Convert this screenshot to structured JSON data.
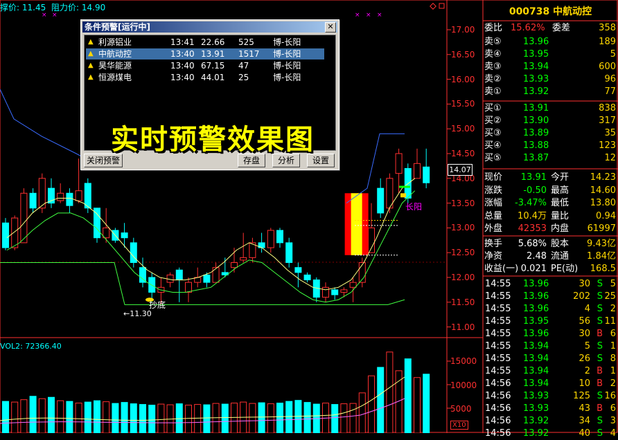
{
  "header": {
    "support_label": "撑价: 11.45",
    "resistance_label": "阻力价: 14.90"
  },
  "volume_header": "VOL2: 72366.40",
  "price_axis": [
    "17.00",
    "16.50",
    "16.00",
    "15.50",
    "15.00",
    "14.50",
    "14.00",
    "13.50",
    "13.00",
    "12.50",
    "12.00",
    "11.50",
    "11.00"
  ],
  "volume_axis": [
    "15000",
    "10000",
    "5000"
  ],
  "last_price_tag": "14.07",
  "x10_label": "X10",
  "annotations": {
    "chaodi": "抄底",
    "low": "←11.30",
    "changyang": "长阳"
  },
  "dialog": {
    "title": "条件预警[运行中]",
    "close": "✕",
    "rows": [
      {
        "name": "利源铝业",
        "time": "13:41",
        "price": "22.66",
        "volume": "525",
        "signal": "博-长阳",
        "selected": false
      },
      {
        "name": "中航动控",
        "time": "13:40",
        "price": "13.91",
        "volume": "1517",
        "signal": "博-长阳",
        "selected": true
      },
      {
        "name": "昊华能源",
        "time": "13:40",
        "price": "67.15",
        "volume": "47",
        "signal": "博-长阳",
        "selected": false
      },
      {
        "name": "恒源煤电",
        "time": "13:40",
        "price": "44.01",
        "volume": "25",
        "signal": "博-长阳",
        "selected": false
      }
    ],
    "caption": "实时预警效果图",
    "buttons": {
      "close_alert": "关闭预警",
      "save": "存盘",
      "analyze": "分析",
      "settings": "设置"
    }
  },
  "panel": {
    "title": "000738 中航动控",
    "webi": {
      "label": "委比",
      "value": "15.62%",
      "label2": "委差",
      "value2": "358"
    },
    "asks": [
      {
        "label": "卖⑤",
        "price": "13.96",
        "vol": "189"
      },
      {
        "label": "卖④",
        "price": "13.95",
        "vol": "5"
      },
      {
        "label": "卖③",
        "price": "13.94",
        "vol": "600"
      },
      {
        "label": "卖②",
        "price": "13.93",
        "vol": "96"
      },
      {
        "label": "卖①",
        "price": "13.92",
        "vol": "77"
      }
    ],
    "bids": [
      {
        "label": "买①",
        "price": "13.91",
        "vol": "838"
      },
      {
        "label": "买②",
        "price": "13.90",
        "vol": "317"
      },
      {
        "label": "买③",
        "price": "13.89",
        "vol": "35"
      },
      {
        "label": "买④",
        "price": "13.88",
        "vol": "123"
      },
      {
        "label": "买⑤",
        "price": "13.87",
        "vol": "12"
      }
    ],
    "stats": [
      {
        "l1": "现价",
        "v1": "13.91",
        "c1": "green",
        "l2": "今开",
        "v2": "14.23",
        "c2": "red"
      },
      {
        "l1": "涨跌",
        "v1": "-0.50",
        "c1": "green",
        "l2": "最高",
        "v2": "14.60",
        "c2": "red"
      },
      {
        "l1": "涨幅",
        "v1": "-3.47%",
        "c1": "green",
        "l2": "最低",
        "v2": "13.80",
        "c2": "green"
      },
      {
        "l1": "总量",
        "v1": "10.4万",
        "c1": "yellow",
        "l2": "量比",
        "v2": "0.94",
        "c2": "yellow"
      },
      {
        "l1": "外盘",
        "v1": "42353",
        "c1": "red",
        "l2": "内盘",
        "v2": "61997",
        "c2": "green"
      }
    ],
    "fundamentals": [
      {
        "l1": "换手",
        "v1": "5.68%",
        "l2": "股本",
        "v2": "9.43亿"
      },
      {
        "l1": "净资",
        "v1": "2.48",
        "l2": "流通",
        "v2": "1.84亿"
      },
      {
        "l1": "收益(一)",
        "v1": "0.021",
        "l2": "PE(动)",
        "v2": "168.5"
      }
    ],
    "ticks": [
      {
        "t": "14:55",
        "p": "13.96",
        "v": "30",
        "s": "S",
        "n": "5"
      },
      {
        "t": "14:55",
        "p": "13.96",
        "v": "202",
        "s": "S",
        "n": "25"
      },
      {
        "t": "14:55",
        "p": "13.96",
        "v": "4",
        "s": "S",
        "n": "2"
      },
      {
        "t": "14:55",
        "p": "13.95",
        "v": "56",
        "s": "S",
        "n": "11"
      },
      {
        "t": "14:55",
        "p": "13.96",
        "v": "30",
        "s": "B",
        "n": "6"
      },
      {
        "t": "14:55",
        "p": "13.94",
        "v": "5",
        "s": "S",
        "n": "1"
      },
      {
        "t": "14:55",
        "p": "13.94",
        "v": "26",
        "s": "S",
        "n": "8"
      },
      {
        "t": "14:55",
        "p": "13.94",
        "v": "2",
        "s": "B",
        "n": "1"
      },
      {
        "t": "14:56",
        "p": "13.94",
        "v": "10",
        "s": "B",
        "n": "2"
      },
      {
        "t": "14:56",
        "p": "13.93",
        "v": "125",
        "s": "S",
        "n": "16"
      },
      {
        "t": "14:56",
        "p": "13.93",
        "v": "43",
        "s": "B",
        "n": "6"
      },
      {
        "t": "14:56",
        "p": "13.92",
        "v": "34",
        "s": "S",
        "n": "3"
      },
      {
        "t": "14:56",
        "p": "13.92",
        "v": "40",
        "s": "S",
        "n": "4"
      }
    ]
  },
  "colors": {
    "up": "#ff3030",
    "down": "#00ffff",
    "ma1": "#ffff80",
    "ma2": "#40ff40",
    "resist": "#3a6bff",
    "grid": "#800000"
  }
}
